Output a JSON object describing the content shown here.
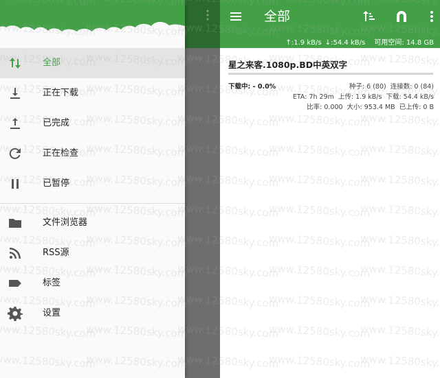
{
  "drawer": {
    "items": [
      {
        "label": "全部",
        "icon": "sort-arrows-icon",
        "active": true
      },
      {
        "label": "正在下载",
        "icon": "download-icon",
        "active": false
      },
      {
        "label": "已完成",
        "icon": "upload-icon",
        "active": false
      },
      {
        "label": "正在检查",
        "icon": "refresh-icon",
        "active": false
      },
      {
        "label": "已暂停",
        "icon": "pause-icon",
        "active": false
      },
      {
        "label": "文件浏览器",
        "icon": "folder-icon",
        "active": false
      },
      {
        "label": "RSS源",
        "icon": "rss-icon",
        "active": false
      },
      {
        "label": "标签",
        "icon": "label-icon",
        "active": false
      },
      {
        "label": "设置",
        "icon": "gear-icon",
        "active": false
      }
    ]
  },
  "appbar": {
    "title": "全部",
    "status": {
      "upload_speed": "↑:1.9 kB/s",
      "download_speed": "↓:54.4 kB/s",
      "free_space": "可用空间:  14.8 GB"
    }
  },
  "torrent": {
    "name": "星之来客.1080p.BD中英双字",
    "progress_percent": 0,
    "state": "下载中: - 0.0%",
    "seeds": "种子: 6 (80)",
    "connections": "连接数: 0 (84)",
    "eta": "ETA: 7h 29m",
    "upload": "上传: 1.9 kB/s",
    "download": "下载: 54.4 kB/s",
    "ratio": "比率: 0.000",
    "size": "大小: 953.4 MB",
    "uploaded": "已上传: 0 B"
  },
  "watermark": "www.12580sky.com",
  "colors": {
    "primary": "#43a047",
    "drawer_bg": "#fafafa",
    "active_bg": "#e4e4e4",
    "scrim": "#6e6e6e"
  }
}
